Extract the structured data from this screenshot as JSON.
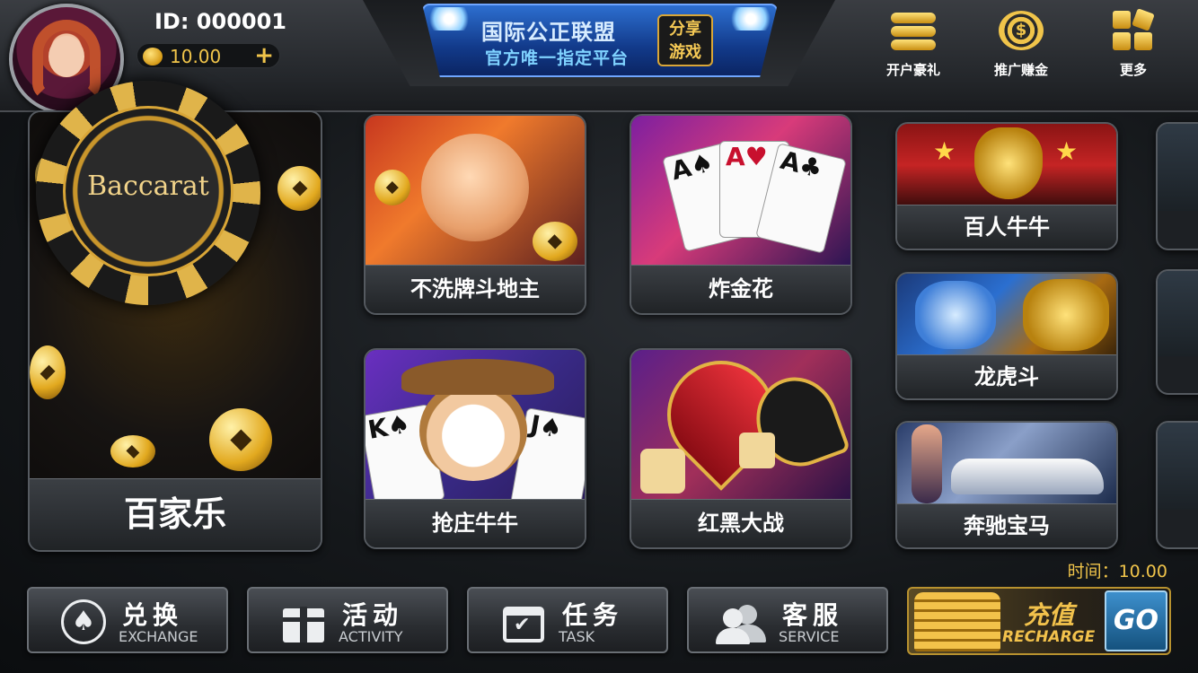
{
  "player": {
    "id_label": "ID:  000001",
    "balance": "10.00",
    "add_symbol": "+"
  },
  "banner": {
    "line1": "国际公正联盟",
    "line2": "官方唯一指定平台",
    "badge_line1": "分享",
    "badge_line2": "游戏"
  },
  "top_actions": [
    {
      "label": "开户豪礼",
      "icon": "gold-bars-icon"
    },
    {
      "label": "推广赚金",
      "icon": "dollar-chip-icon"
    },
    {
      "label": "更多",
      "icon": "grid-more-icon"
    }
  ],
  "games": {
    "baccarat": {
      "name": "百家乐",
      "art_text": "Baccarat"
    },
    "ddz": {
      "name": "不洗牌斗地主"
    },
    "zjh": {
      "name": "炸金花"
    },
    "qzn": {
      "name": "抢庄牛牛"
    },
    "hhdz": {
      "name": "红黑大战"
    },
    "brnn": {
      "name": "百人牛牛"
    },
    "lhd": {
      "name": "龙虎斗"
    },
    "bcbm": {
      "name": "奔驰宝马"
    }
  },
  "timer": "时间：10.00",
  "bottom_buttons": [
    {
      "cn": "兑换",
      "en": "EXCHANGE",
      "icon": "spade-coin-icon"
    },
    {
      "cn": "活动",
      "en": "ACTIVITY",
      "icon": "gift-icon"
    },
    {
      "cn": "任务",
      "en": "TASK",
      "icon": "calendar-check-icon"
    },
    {
      "cn": "客服",
      "en": "SERVICE",
      "icon": "support-people-icon"
    }
  ],
  "recharge": {
    "cn": "充值",
    "en": "RECHARGE",
    "go": "GO"
  },
  "colors": {
    "gold": "#f0c44a",
    "go_blue": "#3d8fcc",
    "panel": "#2a2d31"
  }
}
